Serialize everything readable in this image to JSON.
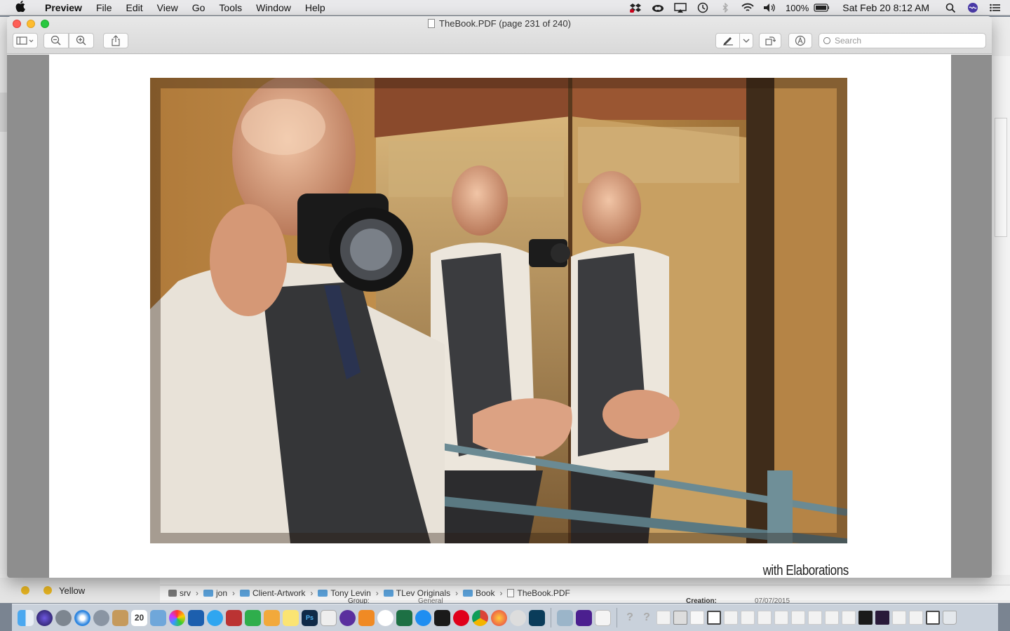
{
  "menubar": {
    "app_name": "Preview",
    "menus": [
      "File",
      "Edit",
      "View",
      "Go",
      "Tools",
      "Window",
      "Help"
    ],
    "battery": "100%",
    "clock": "Sat Feb 20  8:12 AM"
  },
  "window": {
    "title": "TheBook.PDF (page 231 of 240)",
    "search_placeholder": "Search"
  },
  "document": {
    "caption": "with Elaborations"
  },
  "background": {
    "tag_label": "Yellow",
    "path": [
      "srv",
      "jon",
      "Client-Artwork",
      "Tony Levin",
      "TLev Originals",
      "Book",
      "TheBook.PDF"
    ],
    "strip_group_label": "Group:",
    "strip_group_value": "General",
    "strip_creation_label": "Creation:",
    "strip_creation_value": "07/07/2015"
  },
  "dock": {
    "calendar_day": "20"
  },
  "colors": {
    "close": "#fe5f57",
    "minimize": "#febc2e",
    "zoom": "#28c840",
    "folder": "#5aa0d8"
  }
}
